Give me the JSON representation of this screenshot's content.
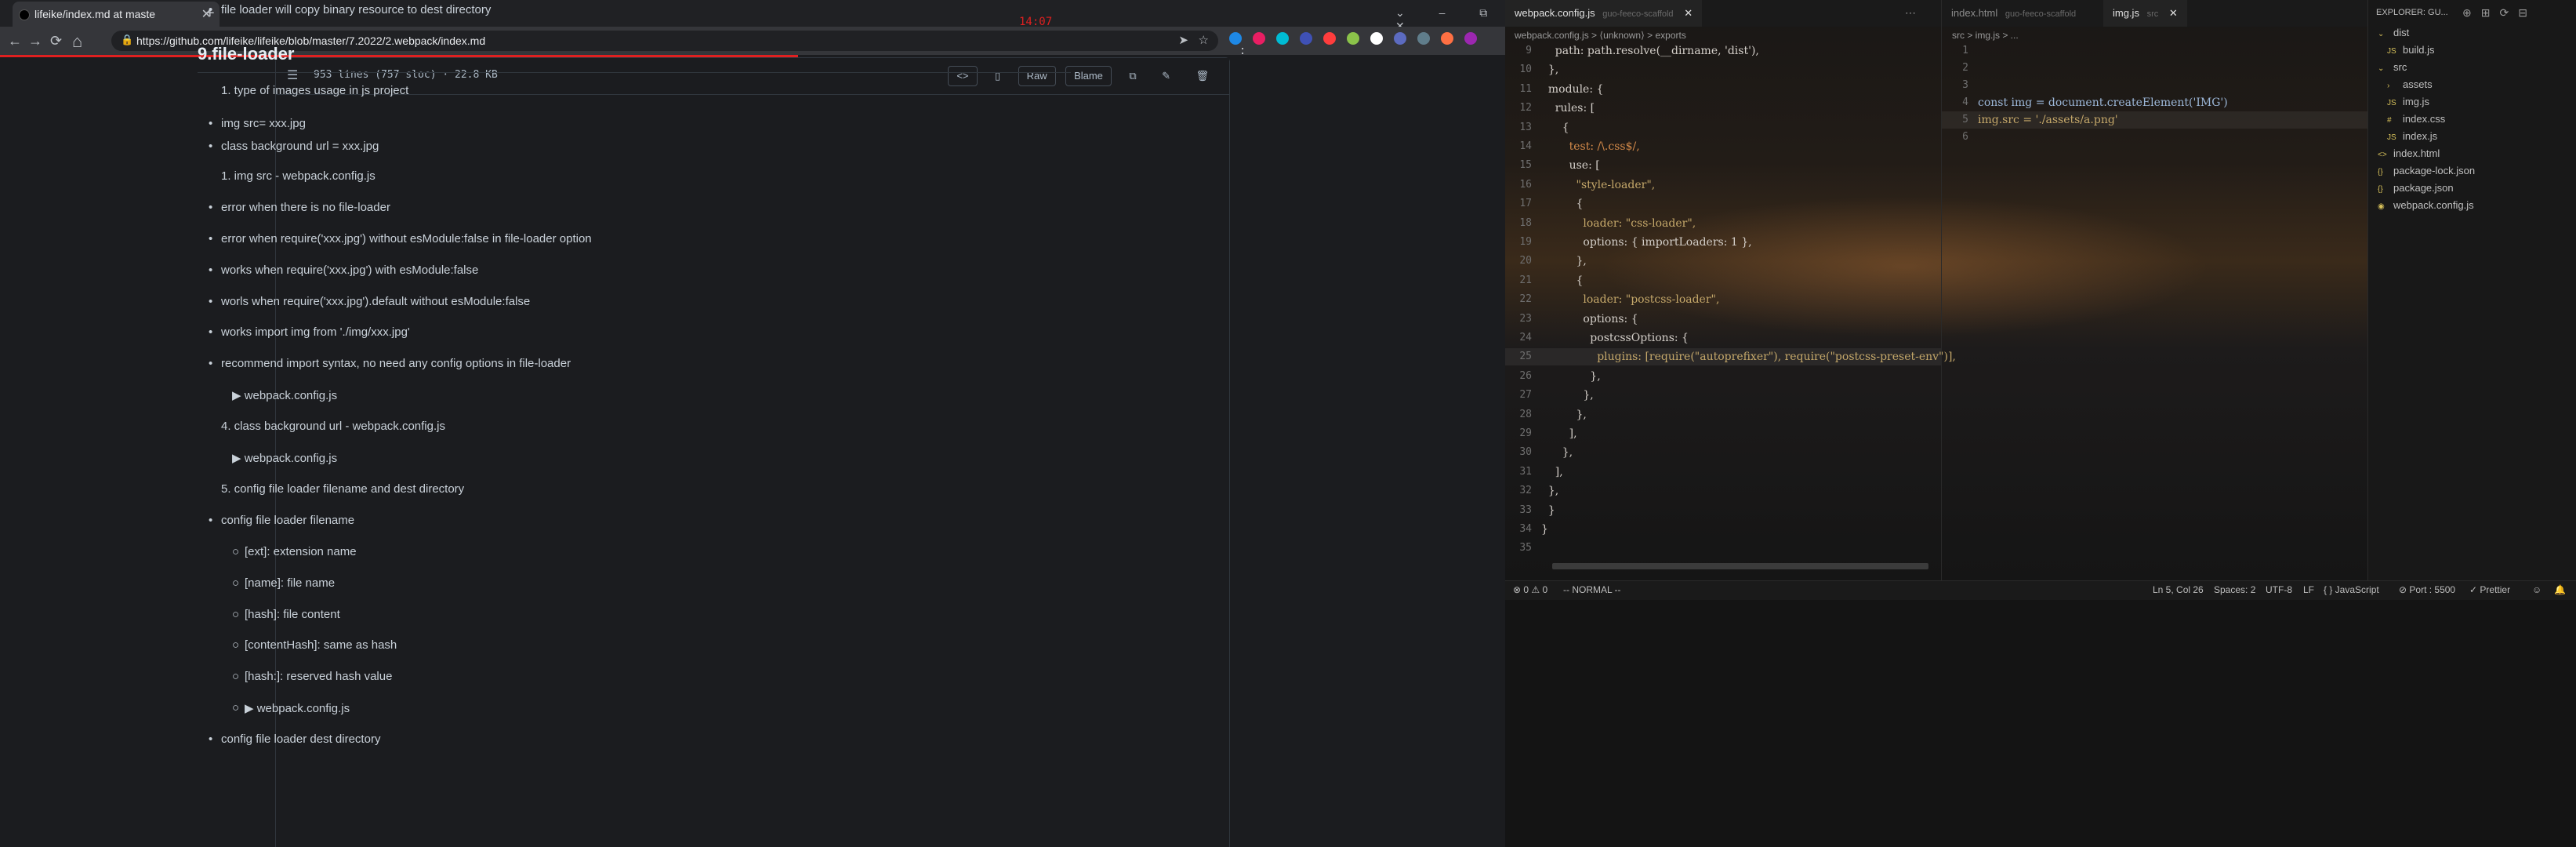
{
  "browser": {
    "tab_title": "lifeike/index.md at maste",
    "url": "https://github.com/lifeike/lifeike/blob/master/7.2022/2.webpack/index.md",
    "clock": "14:07",
    "nav": {
      "back": "←",
      "forward": "→",
      "reload": "⟳",
      "home": "⌂"
    },
    "extensions_colors": [
      "#1e88e5",
      "#e91e63",
      "#00bcd4",
      "#3f51b5",
      "#ff3d3d",
      "#8bc34a",
      "#ffffff",
      "#5c6bc0",
      "#607d8b",
      "#ff7043",
      "#9c27b0"
    ]
  },
  "github": {
    "file_meta": "953 lines (757 sloc)  ·  22.8 KB",
    "actions": {
      "code": "<>",
      "preview": "▯",
      "raw": "Raw",
      "blame": "Blame",
      "copy": "⧉",
      "edit": "✎",
      "delete": "🗑"
    },
    "md_lines": [
      {
        "text": "file loader will copy binary resource to dest directory",
        "kind": "bullet",
        "indent": 0
      },
      {
        "text": "9.file-loader",
        "kind": "h2",
        "indent": 0
      },
      {
        "text": "1. type of images usage in js project",
        "kind": "num",
        "indent": 0
      },
      {
        "text": "img src= xxx.jpg",
        "kind": "bullet",
        "indent": 0
      },
      {
        "text": "class background url = xxx.jpg",
        "kind": "bullet",
        "indent": 0
      },
      {
        "text": "1. img src - webpack.config.js",
        "kind": "num",
        "indent": 0
      },
      {
        "text": "error when there is no file-loader",
        "kind": "bullet",
        "indent": 0
      },
      {
        "text": "error when require('xxx.jpg') without esModule:false in file-loader option",
        "kind": "bullet",
        "indent": 0
      },
      {
        "text": "works when require('xxx.jpg') with esModule:false",
        "kind": "bullet",
        "indent": 0
      },
      {
        "text": "worls when require('xxx.jpg').default without esModule:false",
        "kind": "bullet",
        "indent": 0
      },
      {
        "text": "works import img from './img/xxx.jpg'",
        "kind": "bullet",
        "indent": 0
      },
      {
        "text": "recommend import syntax, no need any config options in file-loader",
        "kind": "bullet",
        "indent": 0
      },
      {
        "text": "▶ webpack.config.js",
        "kind": "details",
        "indent": 0
      },
      {
        "text": "4. class background url - webpack.config.js",
        "kind": "num",
        "indent": 0
      },
      {
        "text": "▶ webpack.config.js",
        "kind": "details",
        "indent": 0
      },
      {
        "text": "5. config file loader filename and dest directory",
        "kind": "num",
        "indent": 0
      },
      {
        "text": "config file loader filename",
        "kind": "bullet",
        "indent": 0
      },
      {
        "text": "[ext]: extension name",
        "kind": "circle",
        "indent": 1
      },
      {
        "text": "[name]: file name",
        "kind": "circle",
        "indent": 1
      },
      {
        "text": "[hash]: file content",
        "kind": "circle",
        "indent": 1
      },
      {
        "text": "[contentHash]: same as hash",
        "kind": "circle",
        "indent": 1
      },
      {
        "text": "[hash:]: reserved hash value",
        "kind": "circle",
        "indent": 1
      },
      {
        "text": "▶ webpack.config.js",
        "kind": "circle",
        "indent": 1
      },
      {
        "text": "config file loader dest directory",
        "kind": "bullet",
        "indent": 0
      }
    ]
  },
  "vscode": {
    "left_tabs": [
      {
        "name": "webpack.config.js",
        "dir": "guo-feeco-scaffold",
        "close": "✕"
      }
    ],
    "right_tabs": [
      {
        "name": "index.html",
        "dir": "guo-feeco-scaffold"
      },
      {
        "name": "img.js",
        "dir": "src",
        "close": "✕"
      }
    ],
    "left_breadcrumb": "webpack.config.js  >  ⟨unknown⟩  >  exports",
    "right_breadcrumb": "src  >  img.js  >  ...",
    "left_lines": [
      {
        "n": "9",
        "t": "    path: path.resolve(__dirname, 'dist'),",
        "cls": ""
      },
      {
        "n": "10",
        "t": "  },",
        "cls": ""
      },
      {
        "n": "11",
        "t": "  module: {",
        "cls": ""
      },
      {
        "n": "12",
        "t": "    rules: [",
        "cls": ""
      },
      {
        "n": "13",
        "t": "      {",
        "cls": ""
      },
      {
        "n": "14",
        "t": "        test: /\\.css$/,",
        "cls": "rgx"
      },
      {
        "n": "15",
        "t": "        use: [",
        "cls": ""
      },
      {
        "n": "16",
        "t": "          \"style-loader\",",
        "cls": "str"
      },
      {
        "n": "17",
        "t": "          {",
        "cls": ""
      },
      {
        "n": "18",
        "t": "            loader: \"css-loader\",",
        "cls": "str"
      },
      {
        "n": "19",
        "t": "            options: { importLoaders: 1 },",
        "cls": ""
      },
      {
        "n": "20",
        "t": "          },",
        "cls": ""
      },
      {
        "n": "21",
        "t": "          {",
        "cls": ""
      },
      {
        "n": "22",
        "t": "            loader: \"postcss-loader\",",
        "cls": "str"
      },
      {
        "n": "23",
        "t": "            options: {",
        "cls": ""
      },
      {
        "n": "24",
        "t": "              postcssOptions: {",
        "cls": ""
      },
      {
        "n": "25",
        "t": "                plugins: [require(\"autoprefixer\"), require(\"postcss-preset-env\")],",
        "cls": "str hl"
      },
      {
        "n": "26",
        "t": "              },",
        "cls": ""
      },
      {
        "n": "27",
        "t": "            },",
        "cls": ""
      },
      {
        "n": "28",
        "t": "          },",
        "cls": ""
      },
      {
        "n": "29",
        "t": "        ],",
        "cls": ""
      },
      {
        "n": "30",
        "t": "      },",
        "cls": ""
      },
      {
        "n": "31",
        "t": "    ],",
        "cls": ""
      },
      {
        "n": "32",
        "t": "  },",
        "cls": ""
      },
      {
        "n": "33",
        "t": "  }",
        "cls": ""
      },
      {
        "n": "34",
        "t": "}",
        "cls": ""
      },
      {
        "n": "35",
        "t": "",
        "cls": ""
      }
    ],
    "right_lines": [
      {
        "n": "1",
        "t": "",
        "cls": ""
      },
      {
        "n": "2",
        "t": "",
        "cls": ""
      },
      {
        "n": "3",
        "t": "",
        "cls": ""
      },
      {
        "n": "4",
        "t": "const img = document.createElement('IMG')",
        "cls": "kw"
      },
      {
        "n": "5",
        "t": "img.src = './assets/a.png'",
        "cls": "str hl"
      },
      {
        "n": "6",
        "t": "",
        "cls": ""
      }
    ],
    "explorer": {
      "title": "EXPLORER: GU...",
      "items": [
        {
          "label": "dist",
          "icon": "⌄",
          "depth": 0
        },
        {
          "label": "build.js",
          "icon": "JS",
          "depth": 1
        },
        {
          "label": "src",
          "icon": "⌄",
          "depth": 0
        },
        {
          "label": "assets",
          "icon": "›",
          "depth": 1
        },
        {
          "label": "img.js",
          "icon": "JS",
          "depth": 1
        },
        {
          "label": "index.css",
          "icon": "#",
          "depth": 1
        },
        {
          "label": "index.js",
          "icon": "JS",
          "depth": 1
        },
        {
          "label": "index.html",
          "icon": "<>",
          "depth": 0
        },
        {
          "label": "package-lock.json",
          "icon": "{}",
          "depth": 0
        },
        {
          "label": "package.json",
          "icon": "{}",
          "depth": 0
        },
        {
          "label": "webpack.config.js",
          "icon": "◉",
          "depth": 0
        }
      ]
    },
    "status": {
      "problems": "⊗ 0 ⚠ 0",
      "mode": "-- NORMAL --",
      "position": "Ln 5, Col 26",
      "spaces": "Spaces: 2",
      "encoding": "UTF-8",
      "eol": "LF",
      "language": "{ } JavaScript",
      "port": "⊘ Port : 5500",
      "prettier": "✓ Prettier"
    }
  }
}
